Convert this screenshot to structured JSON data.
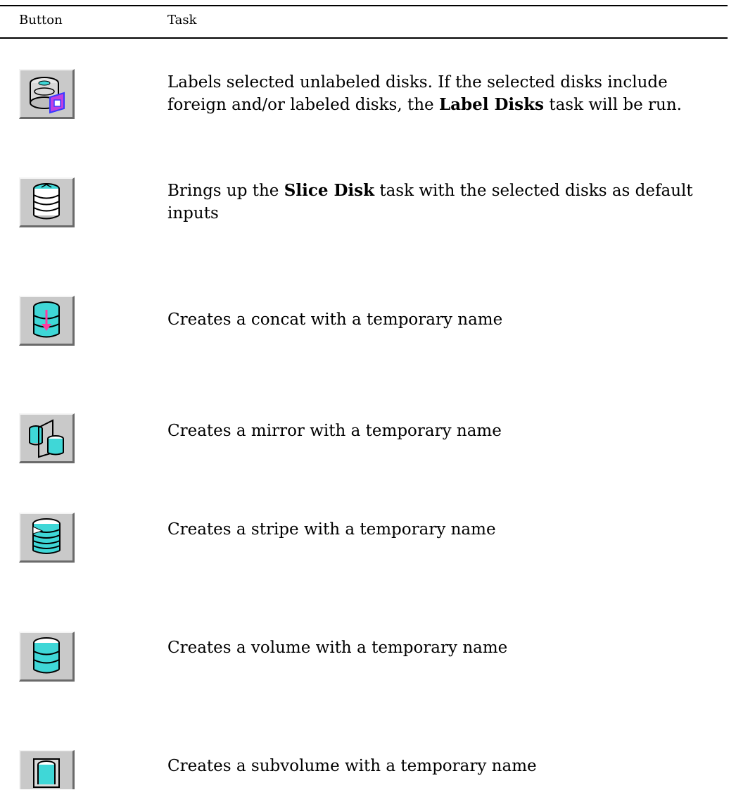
{
  "table": {
    "header": {
      "button": "Button",
      "task": "Task"
    },
    "rows": [
      {
        "icon": "label-disks-icon",
        "text_before": "Labels selected unlabeled disks. If the selected disks include foreign and/or labeled disks, the ",
        "bold": "Label Disks",
        "text_after": " task will be run."
      },
      {
        "icon": "slice-disk-icon",
        "text_before": "Brings up the ",
        "bold": "Slice Disk",
        "text_after": " task with the selected disks as default inputs"
      },
      {
        "icon": "create-concat-icon",
        "text": "Creates a concat with a temporary name"
      },
      {
        "icon": "create-mirror-icon",
        "text": "Creates a mirror with a temporary name"
      },
      {
        "icon": "create-stripe-icon",
        "text": "Creates a stripe with a temporary name"
      },
      {
        "icon": "create-volume-icon",
        "text": "Creates a volume with a temporary name"
      },
      {
        "icon": "create-subvolume-icon",
        "text": "Creates a subvolume with a temporary name"
      }
    ]
  },
  "colors": {
    "disk_cyan": "#3fd7d7",
    "button_face": "#c9c9c9",
    "label_blue": "#3a3aff",
    "label_magenta": "#c040e0",
    "arrow_pink": "#ff3aa0"
  }
}
